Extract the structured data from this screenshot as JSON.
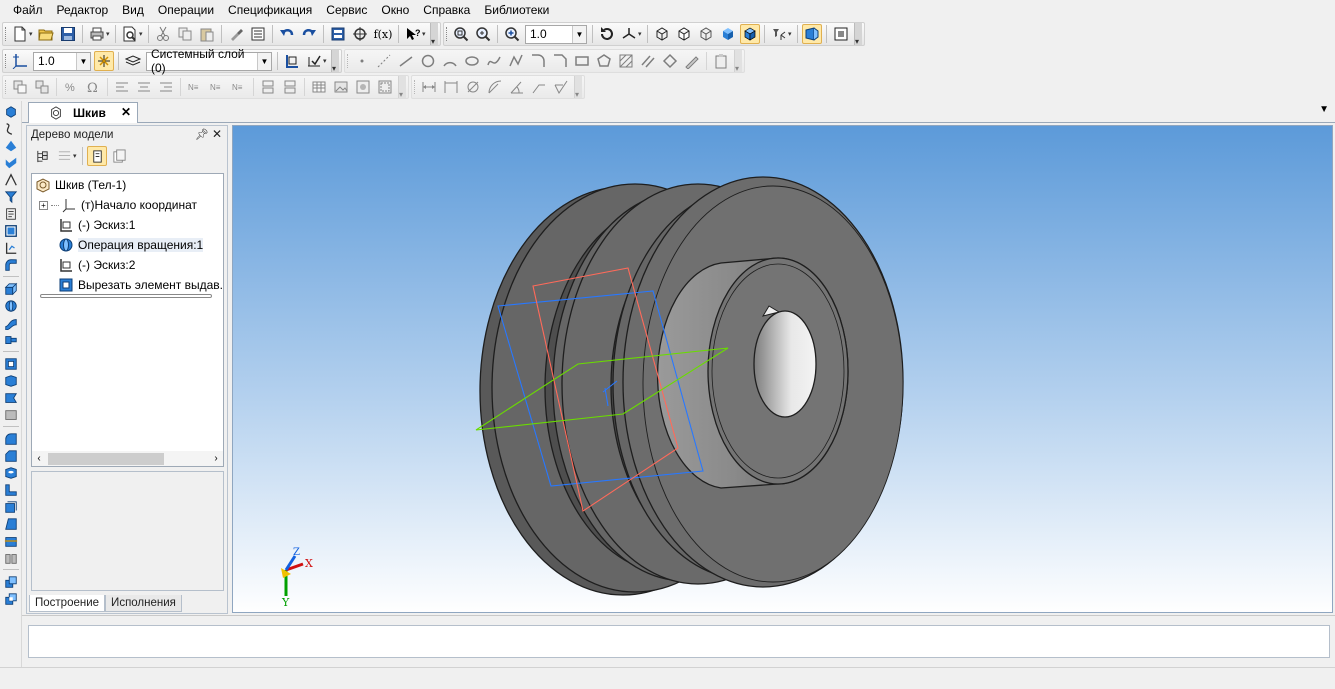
{
  "menu": [
    {
      "label": "Файл"
    },
    {
      "label": "Редактор"
    },
    {
      "label": "Вид"
    },
    {
      "label": "Операции"
    },
    {
      "label": "Спецификация"
    },
    {
      "label": "Сервис"
    },
    {
      "label": "Окно"
    },
    {
      "label": "Справка"
    },
    {
      "label": "Библиотеки"
    }
  ],
  "toolbar1": {
    "fx_label": "f(x)",
    "zoom_value": "1.0"
  },
  "toolbar2": {
    "step_value": "1.0",
    "layer_value": "Системный слой (0)"
  },
  "document_tab": {
    "title": "Шкив",
    "close": "✕"
  },
  "model_tree": {
    "header": "Дерево модели",
    "nodes": [
      {
        "label": "Шкив (Тел-1)",
        "icon": "part-icon"
      },
      {
        "label": "(т)Начало координат",
        "icon": "origin-icon"
      },
      {
        "label": "(-) Эскиз:1",
        "icon": "sketch-icon"
      },
      {
        "label": "Операция вращения:1",
        "icon": "revolve-icon"
      },
      {
        "label": "(-) Эскиз:2",
        "icon": "sketch-icon"
      },
      {
        "label": "Вырезать элемент выдав...",
        "icon": "extrude-cut-icon"
      }
    ],
    "tabs": [
      {
        "label": "Построение"
      },
      {
        "label": "Исполнения"
      }
    ]
  },
  "triad": {
    "x_label": "X",
    "y_label": "Y",
    "z_label": "Z"
  },
  "colors": {
    "viewport_top": "#5c9ad9",
    "viewport_bottom": "#ffffff",
    "part_body": "#6e6e6e",
    "selection": "#ffe9a8"
  }
}
